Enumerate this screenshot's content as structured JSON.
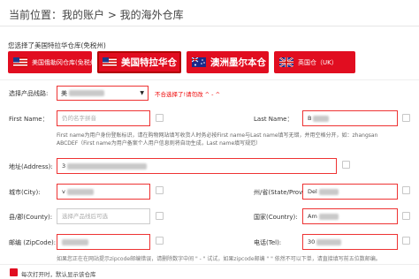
{
  "breadcrumb": "当前位置：我的账户 > 我的海外仓库",
  "selected": {
    "label": "您选择了",
    "value": "美国特拉华仓库(免税州)"
  },
  "warehouses": [
    {
      "label": "美国俄勒冈仓库(免税州)",
      "flag": "us-flag-icon"
    },
    {
      "label": "美国特拉华仓",
      "flag": "us-flag-icon"
    },
    {
      "label": "澳洲墨尔本仓",
      "flag": "au-flag-icon"
    },
    {
      "label": "英国仓（UK）",
      "flag": "uk-flag-icon"
    }
  ],
  "form": {
    "product_line_label": "选择产品线路:",
    "product_line_value": "美",
    "product_line_hint": "不合选择了!请勿改 ^ - ^",
    "first_name_label": "First Name：",
    "first_name_placeholder": "仍的名字拼音",
    "last_name_label": "Last Name：",
    "last_name_value": "B",
    "name_hint": [
      "First name为用户身份登账标识，请在购物网站填写收货人时务必按First name与Last name填写无错，并用空格分开，如：zhangsan",
      "ABCDEF（First name为用户备案个人用户信息则将自动生成，Last name填写规范）"
    ],
    "address_label": "地址(Address):",
    "address_value": "3",
    "city_label": "城市(City):",
    "city_value": "v",
    "state_label": "州/省(State/Prov.):",
    "state_value": "Del",
    "county_label": "县/郡(County):",
    "county_placeholder": "选择产品线后可选",
    "country_label": "国家(Country):",
    "country_value": "Am",
    "zip_label": "邮编 (ZipCode):",
    "tel_label": "电话(Tel):",
    "tel_value": "30",
    "tel_hint": "如果您正在在网站提示zipcode邮编错误，请删除数字中间 \" - \" 试试，如果zipcode邮编 \" \" 依然不可以下单，请直接填写前五位数邮编。",
    "bottom_check_label": "每次打开时，默认显示该仓库"
  },
  "colors": {
    "accent": "#e10d20",
    "input_border": "#e33333"
  }
}
